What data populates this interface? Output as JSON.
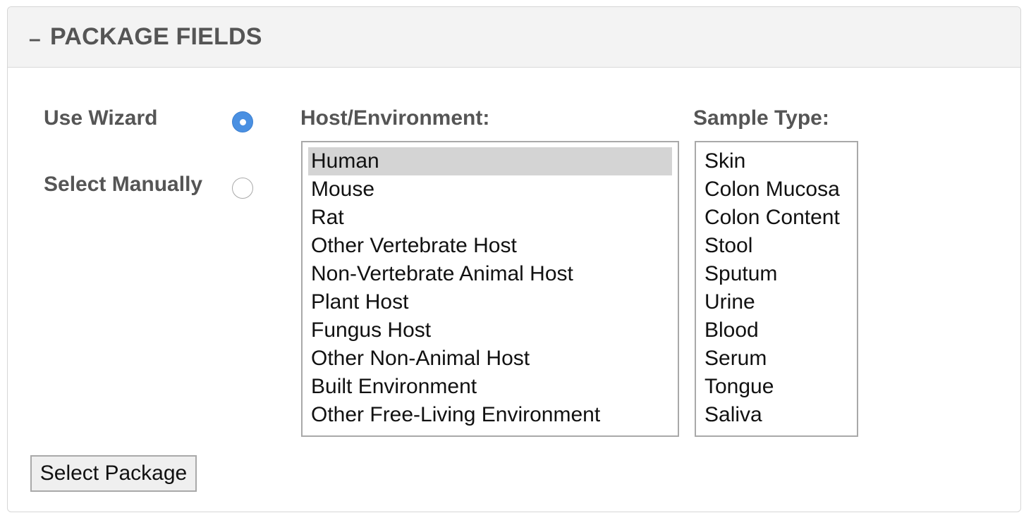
{
  "panel": {
    "collapse_symbol": "–",
    "title": "PACKAGE FIELDS"
  },
  "mode": {
    "wizard_label": "Use Wizard",
    "manual_label": "Select Manually",
    "selected": "wizard"
  },
  "host": {
    "label": "Host/Environment:",
    "options": [
      "Human",
      "Mouse",
      "Rat",
      "Other Vertebrate Host",
      "Non-Vertebrate Animal Host",
      "Plant Host",
      "Fungus Host",
      "Other Non-Animal Host",
      "Built Environment",
      "Other Free-Living Environment"
    ],
    "selected": "Human"
  },
  "sample": {
    "label": "Sample Type:",
    "options": [
      "Skin",
      "Colon Mucosa",
      "Colon Content",
      "Stool",
      "Sputum",
      "Urine",
      "Blood",
      "Serum",
      "Tongue",
      "Saliva"
    ]
  },
  "actions": {
    "select_package_label": "Select Package"
  },
  "colors": {
    "accent": "#4a90e2",
    "header_bg": "#f3f3f3",
    "label_text": "#555555",
    "selected_option_bg": "#d4d4d4"
  }
}
